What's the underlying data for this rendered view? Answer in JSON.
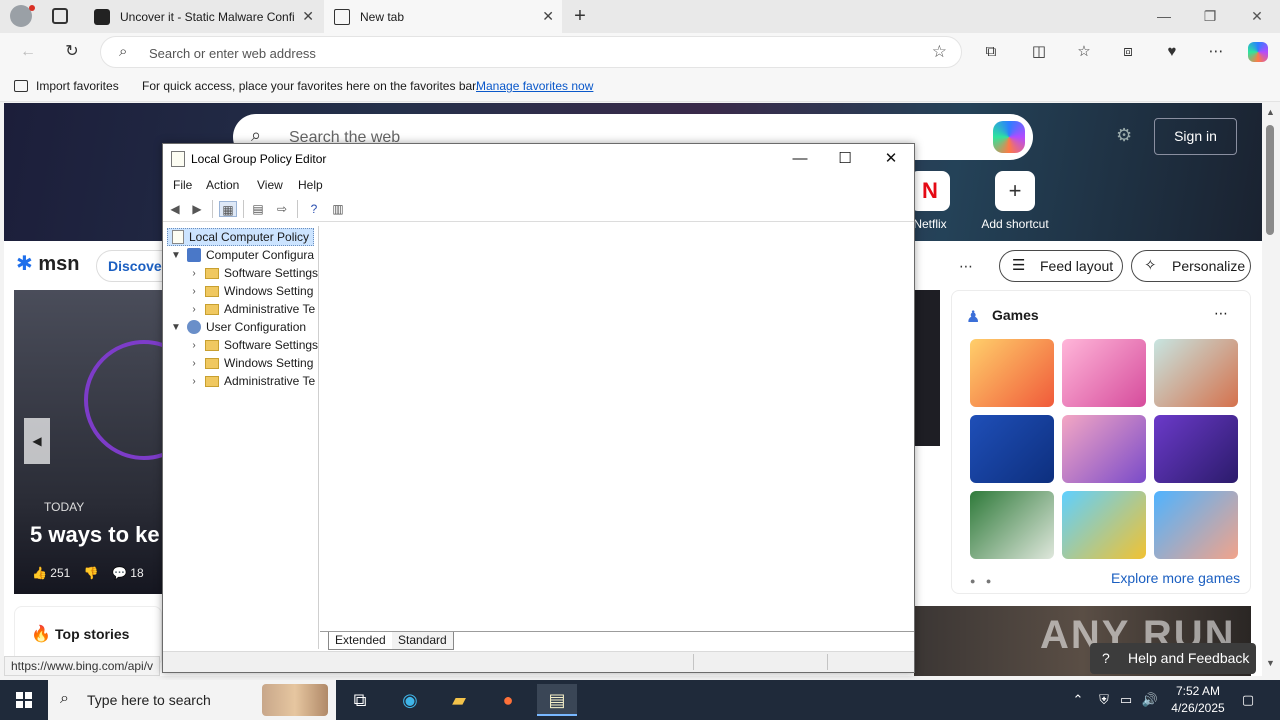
{
  "browser": {
    "tabs": [
      {
        "title": "Uncover it - Static Malware Confi",
        "active": false
      },
      {
        "title": "New tab",
        "active": true
      }
    ],
    "address_placeholder": "Search or enter web address",
    "favorites_bar": {
      "import_label": "Import favorites",
      "message": "For quick access, place your favorites here on the favorites bar.",
      "manage_link": "Manage favorites now"
    }
  },
  "ntp": {
    "search_placeholder": "Search the web",
    "sign_in": "Sign in",
    "shortcuts": [
      {
        "label": "Netflix",
        "glyph": "N"
      },
      {
        "label": "Add shortcut",
        "glyph": "+"
      }
    ],
    "msn_logo": "msn",
    "discover_label": "Discover",
    "feed_layout": "Feed layout",
    "personalize": "Personalize",
    "news": {
      "source": "TODAY",
      "headline": "5 ways to ke",
      "likes": "251",
      "comments": "18"
    },
    "top_stories": "Top stories",
    "games": {
      "title": "Games",
      "explore": "Explore more games"
    },
    "help_feedback": "Help and Feedback",
    "status_url": "https://www.bing.com/api/v",
    "watermark": "ANY RUN"
  },
  "gpe": {
    "title": "Local Group Policy Editor",
    "menu": [
      "File",
      "Action",
      "View",
      "Help"
    ],
    "tree": {
      "root": "Local Computer Policy",
      "computer": "Computer Configura",
      "computer_children": [
        "Software Settings",
        "Windows Setting",
        "Administrative Te"
      ],
      "user": "User Configuration",
      "user_children": [
        "Software Settings",
        "Windows Setting",
        "Administrative Te"
      ]
    },
    "tabs": [
      "Extended",
      "Standard"
    ]
  },
  "taskbar": {
    "search_placeholder": "Type here to search",
    "time": "7:52 AM",
    "date": "4/26/2025"
  },
  "colors": {
    "accent": "#0a58ca",
    "taskbar": "#1f2a3a",
    "tree_selection": "#cce4ff"
  }
}
